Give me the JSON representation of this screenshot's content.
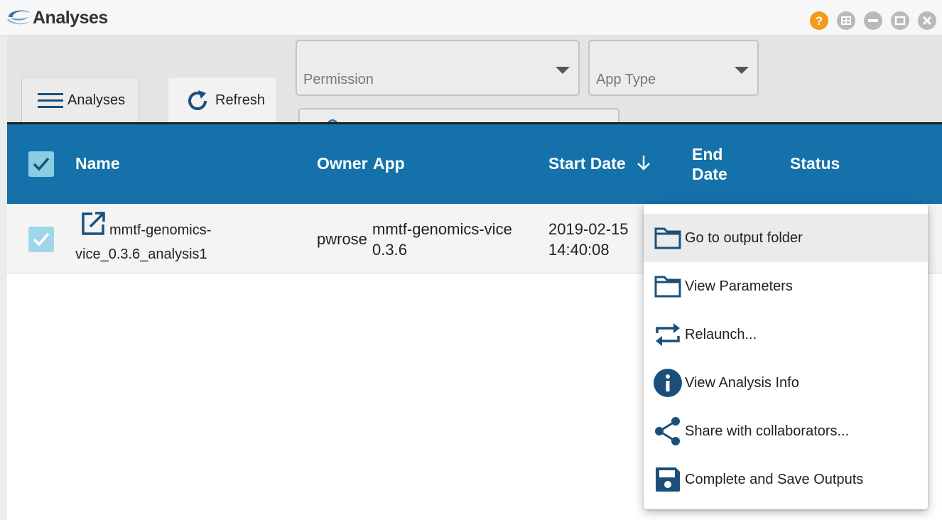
{
  "window": {
    "title": "Analyses",
    "controls": [
      "help-icon",
      "layout-grid-icon",
      "minimize-icon",
      "maximize-icon",
      "close-icon"
    ],
    "colors": {
      "help": "#f39a1e",
      "control": "#b9b9b9"
    }
  },
  "toolbar": {
    "analyses_tab_label": "Analyses",
    "refresh_label": "Refresh",
    "permission_placeholder": "Permission",
    "app_type_placeholder": "App Type"
  },
  "table": {
    "header_color": "#1471aa",
    "columns": {
      "name": "Name",
      "owner": "Owner",
      "app": "App",
      "start_date": "Start Date",
      "end_date_line1": "End",
      "end_date_line2": "Date",
      "status": "Status"
    },
    "sort_indicator": "arrow-down-icon",
    "rows": [
      {
        "selected": true,
        "name_line1": "mmtf-genomics-",
        "name_line2": "vice_0.3.6_analysis1",
        "owner": "pwrose",
        "app_line1": "mmtf-genomics-vice",
        "app_line2": "0.3.6",
        "start_line1": "2019-02-15",
        "start_line2": "14:40:08"
      }
    ]
  },
  "context_menu": {
    "items": [
      {
        "label": "Go to output folder",
        "icon": "folder-icon",
        "active": true
      },
      {
        "label": "View Parameters",
        "icon": "folder-icon"
      },
      {
        "label": "Relaunch...",
        "icon": "relaunch-icon"
      },
      {
        "label": "View Analysis Info",
        "icon": "info-icon"
      },
      {
        "label": "Share with collaborators...",
        "icon": "share-icon"
      },
      {
        "label": "Complete and Save Outputs",
        "icon": "save-icon"
      }
    ]
  }
}
